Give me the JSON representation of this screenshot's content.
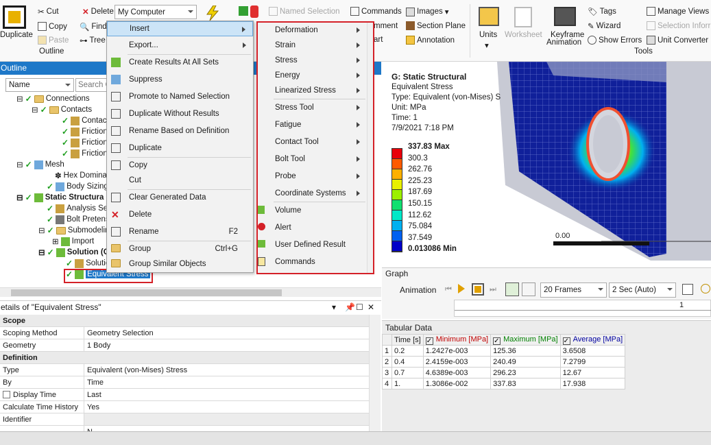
{
  "ribbon": {
    "duplicate": "Duplicate",
    "cut": "Cut",
    "copy": "Copy",
    "paste": "Paste",
    "delete": "Delete",
    "find": "Find",
    "tree": "Tree",
    "outline_group": "Outline",
    "computer_select": "My Computer",
    "named_selection": "Named Selection",
    "commands": "Commands",
    "images": "Images",
    "comment": "mment",
    "section_plane": "Section Plane",
    "chart": "art",
    "annotation": "Annotation",
    "units": "Units",
    "worksheet": "Worksheet",
    "keyframe": "Keyframe",
    "animation": "Animation",
    "tags": "Tags",
    "wizard": "Wizard",
    "show_errors": "Show Errors",
    "manage_views": "Manage Views",
    "selection_info": "Selection Inforr",
    "unit_converter": "Unit Converter",
    "tools_group": "Tools"
  },
  "outline": {
    "title": "Outline",
    "name_col": "Name",
    "search_placeholder": "Search O",
    "nodes": [
      "Connections",
      "Contacts",
      "Contac",
      "Friction",
      "Friction",
      "Friction",
      "Mesh",
      "Hex Dominan",
      "Body Sizing",
      "Static Structura",
      "Analysis Set",
      "Bolt Pretens",
      "Submodeling",
      "Import",
      "Solution (C",
      "Solutio",
      "Equivalent Stress"
    ]
  },
  "context_menu": {
    "items": [
      {
        "label": "Insert",
        "submenu": true
      },
      {
        "label": "Export...",
        "submenu": true
      },
      {
        "label": "Create Results At All Sets"
      },
      {
        "label": "Suppress"
      },
      {
        "label": "Promote to Named Selection"
      },
      {
        "label": "Duplicate Without Results"
      },
      {
        "label": "Rename Based on Definition"
      },
      {
        "label": "Duplicate"
      },
      {
        "label": "Copy"
      },
      {
        "label": "Cut"
      },
      {
        "label": "Clear Generated Data"
      },
      {
        "label": "Delete"
      },
      {
        "label": "Rename",
        "shortcut": "F2"
      },
      {
        "label": "Group",
        "shortcut": "Ctrl+G"
      },
      {
        "label": "Group Similar Objects"
      }
    ]
  },
  "insert_submenu": {
    "items": [
      {
        "label": "Deformation",
        "submenu": true
      },
      {
        "label": "Strain",
        "submenu": true
      },
      {
        "label": "Stress",
        "submenu": true
      },
      {
        "label": "Energy",
        "submenu": true
      },
      {
        "label": "Linearized Stress",
        "submenu": true
      },
      {
        "label": "Stress Tool",
        "submenu": true
      },
      {
        "label": "Fatigue",
        "submenu": true
      },
      {
        "label": "Contact Tool",
        "submenu": true
      },
      {
        "label": "Bolt Tool",
        "submenu": true
      },
      {
        "label": "Probe",
        "submenu": true
      },
      {
        "label": "Coordinate Systems",
        "submenu": true
      },
      {
        "label": "Volume"
      },
      {
        "label": "Alert"
      },
      {
        "label": "User Defined Result"
      },
      {
        "label": "Commands"
      }
    ]
  },
  "result": {
    "title": "G: Static Structural",
    "name": "Equivalent Stress",
    "type": "Type: Equivalent (von-Mises) S",
    "unit": "Unit: MPa",
    "time": "Time: 1",
    "date": "7/9/2021 7:18 PM",
    "legend": [
      "337.83 Max",
      "300.3",
      "262.76",
      "225.23",
      "187.69",
      "150.15",
      "112.62",
      "75.084",
      "37.549",
      "0.013086 Min"
    ],
    "legend_colors": [
      "#e8000a",
      "#ff5a00",
      "#ffb000",
      "#e8f000",
      "#9cf000",
      "#10e070",
      "#00e8c8",
      "#00b0f0",
      "#0060f0",
      "#0000c8"
    ],
    "scale_label": "0.00"
  },
  "graph": {
    "title": "Graph",
    "animation": "Animation",
    "frames": "20 Frames",
    "duration": "2 Sec (Auto)",
    "timeline_value": "1"
  },
  "details": {
    "title": "etails of \"Equivalent Stress\"",
    "rows": [
      {
        "section": "Scope"
      },
      {
        "k": "Scoping Method",
        "v": "Geometry Selection"
      },
      {
        "k": "Geometry",
        "v": "1 Body"
      },
      {
        "section": "Definition"
      },
      {
        "k": "Type",
        "v": "Equivalent (von-Mises) Stress"
      },
      {
        "k": "By",
        "v": "Time"
      },
      {
        "k": "Display Time",
        "v": "Last"
      },
      {
        "k": "Calculate Time History",
        "v": "Yes"
      },
      {
        "k": "Identifier",
        "v": ""
      },
      {
        "k": "",
        "v": "N"
      }
    ]
  },
  "tabular": {
    "title": "Tabular Data",
    "headers": [
      "Time [s]",
      "Minimum [MPa]",
      "Maximum [MPa]",
      "Average [MPa]"
    ],
    "rows": [
      [
        "1",
        "0.2",
        "1.2427e-003",
        "125.36",
        "3.6508"
      ],
      [
        "2",
        "0.4",
        "2.4159e-003",
        "240.49",
        "7.2799"
      ],
      [
        "3",
        "0.7",
        "4.6389e-003",
        "296.23",
        "12.67"
      ],
      [
        "4",
        "1.",
        "1.3086e-002",
        "337.83",
        "17.938"
      ]
    ]
  }
}
